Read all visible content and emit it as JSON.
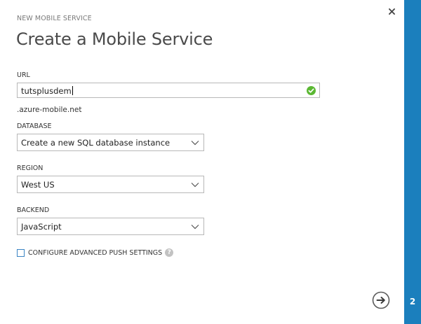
{
  "header": {
    "subtitle": "NEW MOBILE SERVICE",
    "title": "Create a Mobile Service"
  },
  "form": {
    "url": {
      "label": "URL",
      "value": "tutsplusdem",
      "suffix": ".azure-mobile.net",
      "status_icon": "check-circle-icon"
    },
    "database": {
      "label": "DATABASE",
      "selected": "Create a new SQL database instance"
    },
    "region": {
      "label": "REGION",
      "selected": "West US"
    },
    "backend": {
      "label": "BACKEND",
      "selected": "JavaScript"
    },
    "advanced_push": {
      "label": "CONFIGURE ADVANCED PUSH SETTINGS",
      "checked": false,
      "help_glyph": "?"
    }
  },
  "wizard": {
    "current_step": "2"
  },
  "colors": {
    "accent": "#1b7fbd",
    "valid": "#5bb833",
    "checkbox_border": "#3a84c4"
  }
}
